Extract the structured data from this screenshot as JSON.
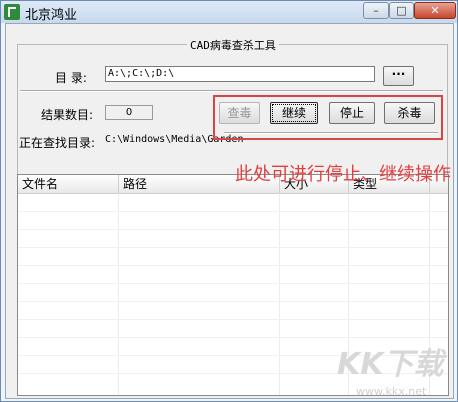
{
  "window": {
    "title": "北京鸿业",
    "controls": {
      "minimize": "–",
      "maximize": "□",
      "close": "✕"
    }
  },
  "group": {
    "title": "CAD病毒查杀工具"
  },
  "directory": {
    "label": "目 录:",
    "value": "A:\\;C:\\;D:\\",
    "browse_label": "···"
  },
  "result": {
    "label": "结果数目:",
    "count": "0"
  },
  "searching": {
    "label": "正在查找目录:",
    "path": "C:\\Windows\\Media\\Garden"
  },
  "buttons": {
    "scan": "查毒",
    "continue": "继续",
    "stop": "停止",
    "kill": "杀毒"
  },
  "list": {
    "columns": [
      "文件名",
      "路径",
      "大小",
      "类型"
    ]
  },
  "annotation": "此处可进行停止、继续操作",
  "watermark": {
    "text": "KK下载",
    "url": "www.kkx.net"
  },
  "colors": {
    "highlight": "#d94545",
    "annotation": "#e04040",
    "app_icon": "#2e8b3c"
  }
}
